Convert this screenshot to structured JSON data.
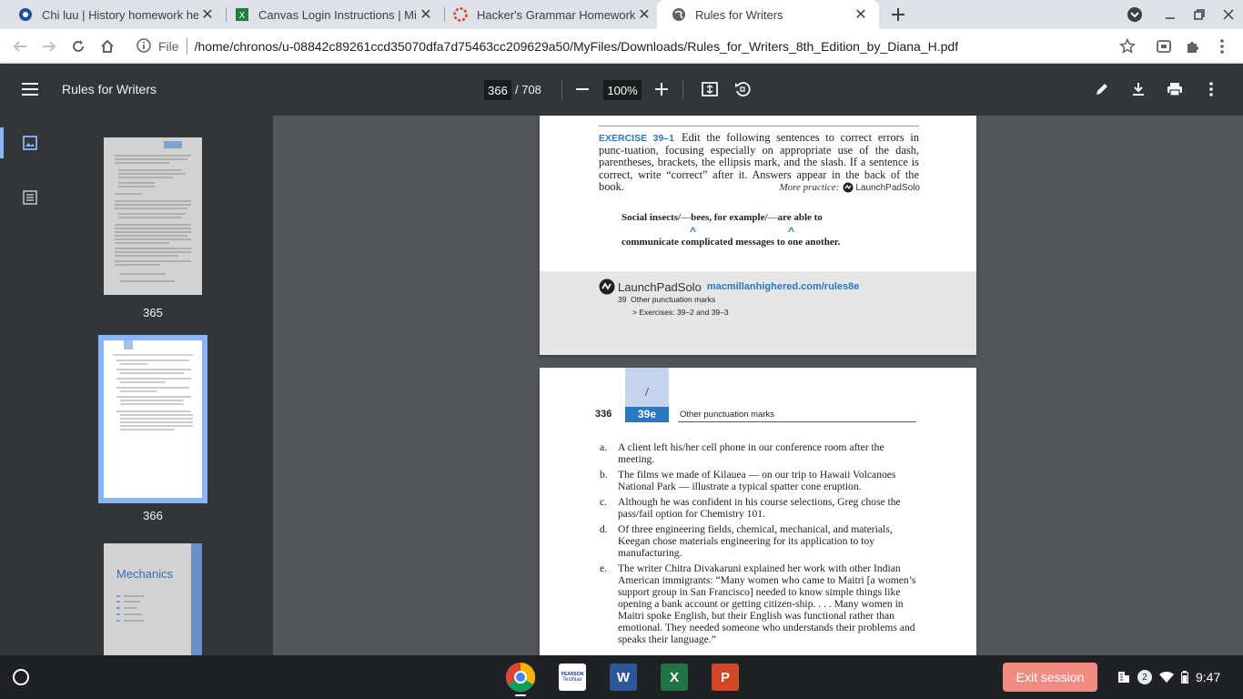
{
  "tabs": [
    {
      "title": "Chi luu | History homework help",
      "icon": "chegg-icon"
    },
    {
      "title": "Canvas Login Instructions | Miss",
      "icon": "canvas-icon"
    },
    {
      "title": "Hacker's Grammar Homework II",
      "icon": "canvas-red-icon"
    },
    {
      "title": "Rules for Writers",
      "icon": "globe-icon"
    }
  ],
  "address": {
    "scheme": "File",
    "url": "/home/chronos/u-08842c89261ccd35070dfa7d75463cc209629a50/MyFiles/Downloads/Rules_for_Writers_8th_Edition_by_Diana_H.pdf"
  },
  "pdf": {
    "title": "Rules for Writers",
    "page": "366",
    "total": "/ 708",
    "zoom": "100%"
  },
  "thumbs": [
    {
      "label": "365"
    },
    {
      "label": "366"
    },
    {
      "label": "Mechanics"
    }
  ],
  "page1": {
    "exercise_label": "EXERCISE 39–1",
    "exercise_text": "Edit the following sentences to correct errors in punc-tuation, focusing especially on appropriate use of the dash, parentheses, brackets, the ellipsis mark, and the slash. If a sentence is correct, write “correct” after it. Answers appear in the back of the book.",
    "more_practice": "More practice:",
    "launchpad_small": "LaunchPadSolo",
    "example_line1_a": "Social insects/",
    "example_dash1": "—",
    "example_line1_b": "bees, for example/",
    "example_dash2": "—",
    "example_line1_c": "are able to",
    "example_line2": "communicate complicated messages to one another.",
    "caret": "^",
    "lp_logo": "LaunchPadSolo",
    "lp_url": "macmillanhighered.com/rules8e",
    "lp_line1": "39  Other punctuation marks",
    "lp_line2": "> Exercises: 39–2 and 39–3"
  },
  "page2": {
    "page_num": "336",
    "tab_symbol": "/",
    "tab_section": "39e",
    "running_head": "Other punctuation marks",
    "items": [
      {
        "letter": "a.",
        "text": "A client left his/her cell phone in our conference room after the meeting."
      },
      {
        "letter": "b.",
        "text": "The films we made of Kilauea — on our trip to Hawaii Volcanoes National Park — illustrate a typical spatter cone eruption."
      },
      {
        "letter": "c.",
        "text": "Although he was confident in his course selections, Greg chose the pass/fail option for Chemistry 101."
      },
      {
        "letter": "d.",
        "text": "Of three engineering fields, chemical, mechanical, and materials, Keegan chose materials engineering for its application to toy manufacturing."
      },
      {
        "letter": "e.",
        "text": "The writer Chitra Divakaruni explained her work with other Indian American immigrants: “Many women who came to Maitri [a women’s support group in San Francisco] needed to know simple things like opening a bank account or getting citizen-ship. . . . Many women in Maitri spoke English, but their English was functional rather than emotional. They needed someone who understands their problems and speaks their language.”"
      }
    ]
  },
  "shelf": {
    "exit_label": "Exit session",
    "notif_count": "2",
    "time": "9:47",
    "testnav_top": "PEARSON",
    "testnav_bottom": "TestNav",
    "word": "W",
    "excel": "X",
    "ppt": "P"
  },
  "colors": {
    "accent": "#1a73e8",
    "pdf_blue": "#2a78c2",
    "exit_bg": "#f28b82"
  }
}
